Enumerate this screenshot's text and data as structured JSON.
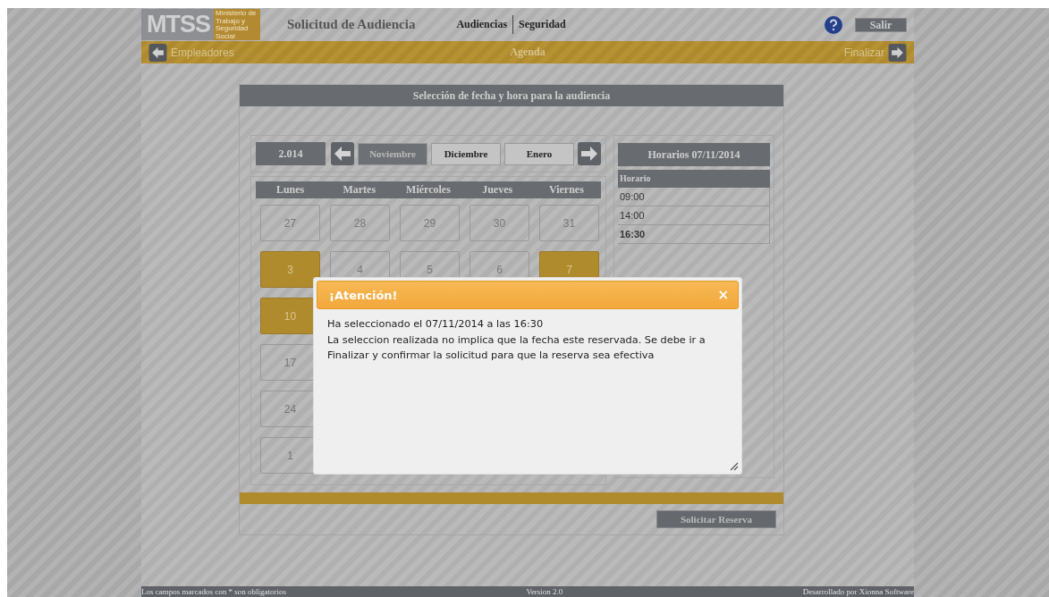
{
  "header": {
    "logo": "MTSS",
    "logo_subtitle": "Ministerio de Trabajo y Seguridad Social",
    "title": "Solicitud de Audiencia",
    "menu": [
      {
        "label": "Audiencias"
      },
      {
        "label": "Seguridad"
      }
    ],
    "logout": "Salir"
  },
  "nav": {
    "back": "Empleadores",
    "current": "Agenda",
    "next": "Finalizar"
  },
  "panel": {
    "title": "Selección de fecha y hora para la audiencia",
    "year": "2.014",
    "months": [
      {
        "label": "Noviembre",
        "selected": true
      },
      {
        "label": "Diciembre",
        "selected": false
      },
      {
        "label": "Enero",
        "selected": false
      }
    ],
    "weekdays": [
      "Lunes",
      "Martes",
      "Miércoles",
      "Jueves",
      "Viernes"
    ],
    "weeks": [
      [
        {
          "day": "27",
          "highlighted": false
        },
        {
          "day": "28",
          "highlighted": false
        },
        {
          "day": "29",
          "highlighted": false
        },
        {
          "day": "30",
          "highlighted": false
        },
        {
          "day": "31",
          "highlighted": false
        }
      ],
      [
        {
          "day": "3",
          "highlighted": true
        },
        {
          "day": "4",
          "highlighted": false
        },
        {
          "day": "5",
          "highlighted": false
        },
        {
          "day": "6",
          "highlighted": false
        },
        {
          "day": "7",
          "highlighted": true
        }
      ],
      [
        {
          "day": "10",
          "highlighted": true
        }
      ],
      [
        {
          "day": "17",
          "highlighted": false
        }
      ],
      [
        {
          "day": "24",
          "highlighted": false
        }
      ],
      [
        {
          "day": "1",
          "highlighted": false
        }
      ]
    ],
    "schedule_title": "Horarios 07/11/2014",
    "schedule_column": "Horario",
    "times": [
      {
        "label": "09:00",
        "selected": false
      },
      {
        "label": "14:00",
        "selected": false
      },
      {
        "label": "16:30",
        "selected": true
      }
    ],
    "submit": "Solicitar Reserva"
  },
  "footer": {
    "note": "Los campos marcados con * son obligatorios",
    "version": "Version 2.0",
    "credit": "Desarrollado por Xionna Software"
  },
  "dialog": {
    "title": "¡Atención!",
    "close": "×",
    "lines": [
      "Ha seleccionado el 07/11/2014 a las 16:30",
      "La seleccion realizada no implica que la fecha este reservada. Se debe ir a Finalizar y confirmar la solicitud para que la reserva sea efectiva"
    ]
  }
}
